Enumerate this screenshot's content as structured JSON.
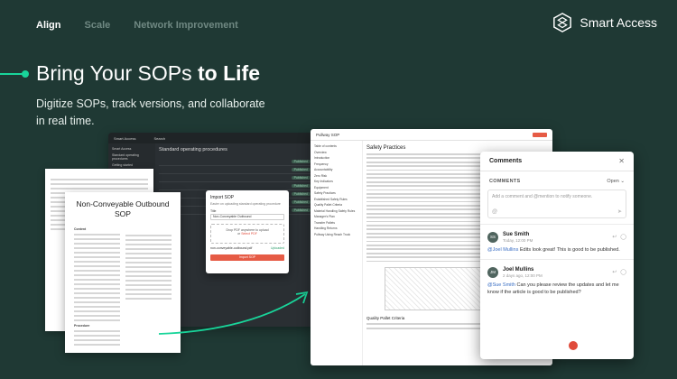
{
  "nav": {
    "tabs": [
      "Align",
      "Scale",
      "Network Improvement"
    ],
    "active": "Align"
  },
  "brand": {
    "name": "Smart Access"
  },
  "hero": {
    "headline_regular": "Bring Your SOPs ",
    "headline_bold": "to Life",
    "subtitle": "Digitize SOPs, track versions, and collaborate in real time."
  },
  "app_window": {
    "brand": "Smart Access",
    "search": "Search",
    "side_items": [
      "Smart Access",
      "Standard operating procedures",
      "Getting started"
    ],
    "title": "Standard operating procedures",
    "rows": [
      "Published",
      "Published",
      "Published",
      "Published",
      "Published",
      "Published",
      "Published"
    ]
  },
  "paper": {
    "title": "Non-Conveyable Outbound SOP",
    "section_content": "Content",
    "section_procedure": "Procedure"
  },
  "import_modal": {
    "title": "Import SOP",
    "subtitle": "Easier on uploading standard operating procedure",
    "title_label": "Title",
    "title_value": "Non-Conveyable Outbound",
    "drop_text": "Drop PDF anywhere to upload",
    "drop_or": "or",
    "drop_link": "Select PDF",
    "file_name": "non-conveyable-outbound.pdf",
    "file_status": "Uploaded",
    "button": "Import SOP"
  },
  "doc": {
    "title": "Pullway SOP",
    "toc_header": "Table of contents",
    "toc": [
      "Overview",
      "Introduction",
      "Frequency",
      "Accountability",
      "Zero Risk",
      "Key Indicators",
      "Equipment",
      "Safety Practices",
      "Established Safety Rules",
      "Quality Pallet Criteria",
      "Material Handling Safety Rules",
      "Manager's Plan",
      "Transfer Pallets",
      "Handling Returns",
      "Pullway Using Reach Truck"
    ],
    "heading": "Safety Practices",
    "subheading": "Quality Pallet Criteria"
  },
  "comments": {
    "title": "Comments",
    "filter_label": "COMMENTS",
    "filter_value": "Open",
    "compose_placeholder": "Add a comment and @mention to notify someone.",
    "items": [
      {
        "initials": "SS",
        "name": "Sue Smith",
        "time": "Today, 12:00 PM",
        "mention": "@Joel Mullins",
        "text": " Edits look great! This is good to be published."
      },
      {
        "initials": "JM",
        "name": "Joel Mullins",
        "time": "2 days ago, 12:00 PM",
        "mention": "@Sue Smith",
        "text": " Can you please review the updates and let me know if the article is good to be published?"
      }
    ]
  },
  "colors": {
    "background": "#1f3934",
    "accent": "#19d59a",
    "primary_button": "#e65b45",
    "mention": "#3b6fc4"
  }
}
